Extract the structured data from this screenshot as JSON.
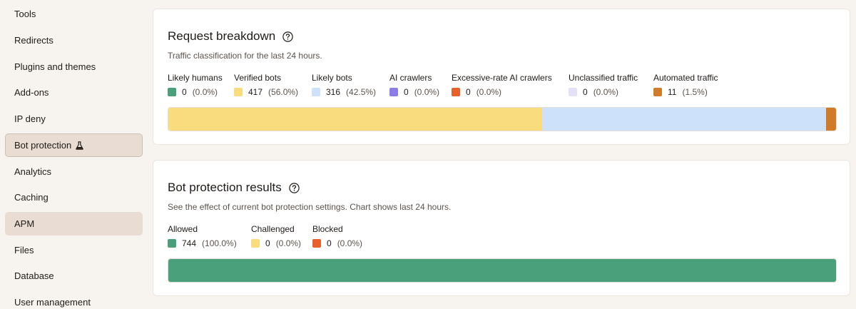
{
  "sidebar": {
    "items": [
      {
        "label": "Tools",
        "state": "normal"
      },
      {
        "label": "Redirects",
        "state": "normal"
      },
      {
        "label": "Plugins and themes",
        "state": "normal"
      },
      {
        "label": "Add-ons",
        "state": "normal"
      },
      {
        "label": "IP deny",
        "state": "normal"
      },
      {
        "label": "Bot protection",
        "state": "active",
        "icon": "flask-icon"
      },
      {
        "label": "Analytics",
        "state": "normal"
      },
      {
        "label": "Caching",
        "state": "normal"
      },
      {
        "label": "APM",
        "state": "selected"
      },
      {
        "label": "Files",
        "state": "normal"
      },
      {
        "label": "Database",
        "state": "normal"
      },
      {
        "label": "User management",
        "state": "normal"
      }
    ]
  },
  "request_breakdown": {
    "title": "Request breakdown",
    "subtitle": "Traffic classification for the last 24 hours.",
    "legend": [
      {
        "label": "Likely humans",
        "count": "0",
        "pct": "(0.0%)",
        "color": "#4aa07a",
        "fraction": 0.0
      },
      {
        "label": "Verified bots",
        "count": "417",
        "pct": "(56.0%)",
        "color": "#f8dc7e",
        "fraction": 0.56
      },
      {
        "label": "Likely bots",
        "count": "316",
        "pct": "(42.5%)",
        "color": "#cde2fa",
        "fraction": 0.425
      },
      {
        "label": "AI crawlers",
        "count": "0",
        "pct": "(0.0%)",
        "color": "#8c7ce6",
        "fraction": 0.0
      },
      {
        "label": "Excessive-rate AI crawlers",
        "count": "0",
        "pct": "(0.0%)",
        "color": "#e8602c",
        "fraction": 0.0
      },
      {
        "label": "Unclassified traffic",
        "count": "0",
        "pct": "(0.0%)",
        "color": "#e4e0f8",
        "fraction": 0.0
      },
      {
        "label": "Automated traffic",
        "count": "11",
        "pct": "(1.5%)",
        "color": "#d07b28",
        "fraction": 0.015
      }
    ]
  },
  "bot_results": {
    "title": "Bot protection results",
    "subtitle": "See the effect of current bot protection settings. Chart shows last 24 hours.",
    "legend": [
      {
        "label": "Allowed",
        "count": "744",
        "pct": "(100.0%)",
        "color": "#4aa07a",
        "fraction": 1.0
      },
      {
        "label": "Challenged",
        "count": "0",
        "pct": "(0.0%)",
        "color": "#f8dc7e",
        "fraction": 0.0
      },
      {
        "label": "Blocked",
        "count": "0",
        "pct": "(0.0%)",
        "color": "#e8602c",
        "fraction": 0.0
      }
    ]
  }
}
